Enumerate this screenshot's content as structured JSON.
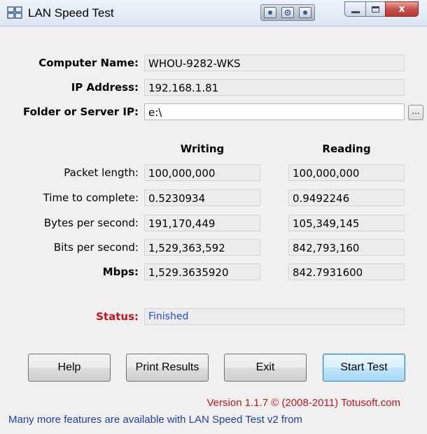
{
  "window": {
    "title": "LAN Speed Test",
    "close_glyph": "x",
    "icons": [
      "app-icon",
      "settings-icon",
      "minimize-icon",
      "maximize-icon",
      "close-icon"
    ]
  },
  "info": {
    "computer_name_label": "Computer Name:",
    "computer_name_value": "WHOU-9282-WKS",
    "ip_label": "IP Address:",
    "ip_value": "192.168.1.81",
    "folder_label": "Folder or Server IP:",
    "folder_value": "e:\\",
    "browse_label": "..."
  },
  "results": {
    "writing_header": "Writing",
    "reading_header": "Reading",
    "rows": [
      {
        "label": "Packet length:",
        "writing": "100,000,000",
        "reading": "100,000,000",
        "bold": false
      },
      {
        "label": "Time to complete:",
        "writing": "0.5230934",
        "reading": "0.9492246",
        "bold": false
      },
      {
        "label": "Bytes per second:",
        "writing": "191,170,449",
        "reading": "105,349,145",
        "bold": false
      },
      {
        "label": "Bits per second:",
        "writing": "1,529,363,592",
        "reading": "842,793,160",
        "bold": false
      },
      {
        "label": "Mbps:",
        "writing": "1,529.3635920",
        "reading": "842.7931600",
        "bold": true
      }
    ]
  },
  "status": {
    "label": "Status:",
    "value": "Finished"
  },
  "buttons": {
    "help": "Help",
    "print": "Print Results",
    "exit": "Exit",
    "start": "Start Test"
  },
  "footer": {
    "version": "Version 1.1.7 © (2008-2011) Totusoft.com",
    "more": "Many more features are available with LAN Speed Test v2 from"
  },
  "colors": {
    "status_label": "#c3161c",
    "status_value": "#1f4fd6",
    "version_text": "#c3161c",
    "more_text": "#1f3fa8"
  }
}
